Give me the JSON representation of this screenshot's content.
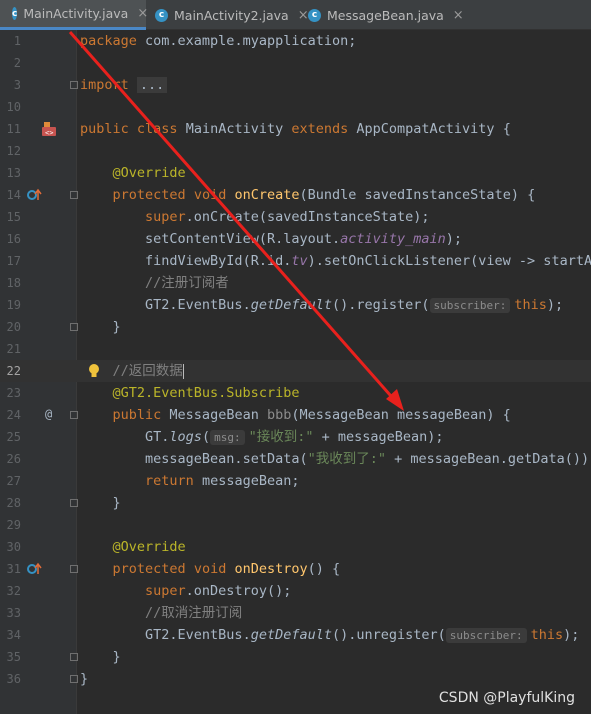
{
  "tabs": [
    {
      "label": "MainActivity.java",
      "icon": "java-class-icon",
      "active": true
    },
    {
      "label": "MainActivity2.java",
      "icon": "java-class-icon",
      "active": false
    },
    {
      "label": "MessageBean.java",
      "icon": "java-class-icon",
      "active": false
    }
  ],
  "line_numbers": [
    "1",
    "2",
    "3",
    "10",
    "11",
    "12",
    "13",
    "14",
    "15",
    "16",
    "17",
    "18",
    "19",
    "20",
    "21",
    "22",
    "23",
    "24",
    "25",
    "26",
    "27",
    "28",
    "29",
    "30",
    "31",
    "32",
    "33",
    "34",
    "35",
    "36"
  ],
  "code": {
    "l1_kw": "package",
    "l1_rest": " com.example.myapplication;",
    "l3_kw": "import",
    "l3_fold": "...",
    "l11_kw1": "public",
    "l11_kw2": "class",
    "l11_name": " MainActivity ",
    "l11_kw3": "extends",
    "l11_rest": " AppCompatActivity {",
    "l13_ann": "@Override",
    "l14_kw1": "protected",
    "l14_kw2": "void",
    "l14_fn": "onCreate",
    "l14_rest": "(Bundle savedInstanceState) {",
    "l15_kw": "super",
    "l15_rest": ".onCreate(savedInstanceState);",
    "l16_a": "setContentView(R.layout.",
    "l16_field": "activity_main",
    "l16_b": ");",
    "l17_a": "findViewById(R.id.",
    "l17_field": "tv",
    "l17_b": ").setOnClickListener(view -> startAc",
    "l18_cmt": "//注册订阅者",
    "l19_a": "GT2.EventBus.",
    "l19_it": "getDefault",
    "l19_b": "().register(",
    "l19_hint": "subscriber:",
    "l19_kw": "this",
    "l19_c": ");",
    "l20": "}",
    "l22_cmt": "//返回数据",
    "l23_ann": "@GT2.EventBus.Subscribe",
    "l24_kw": "public",
    "l24_a": " MessageBean ",
    "l24_unused": "bbb",
    "l24_b": "(MessageBean messageBean) {",
    "l25_a": "GT.",
    "l25_it": "logs",
    "l25_b": "(",
    "l25_hint": "msg:",
    "l25_str": "\"接收到:\"",
    "l25_c": " + messageBean);",
    "l26_a": "messageBean.setData(",
    "l26_str": "\"我收到了:\"",
    "l26_b": " + messageBean.getData());",
    "l27_kw": "return",
    "l27_rest": " messageBean;",
    "l28": "}",
    "l30_ann": "@Override",
    "l31_kw1": "protected",
    "l31_kw2": "void",
    "l31_fn": "onDestroy",
    "l31_rest": "() {",
    "l32_kw": "super",
    "l32_rest": ".onDestroy();",
    "l33_cmt": "//取消注册订阅",
    "l34_a": "GT2.EventBus.",
    "l34_it": "getDefault",
    "l34_b": "().unregister(",
    "l34_hint": "subscriber:",
    "l34_kw": "this",
    "l34_c": ");",
    "l35": "}",
    "l36": "}"
  },
  "gutter_icons": {
    "line11": "android-activity-icon",
    "line14": "override-method-icon",
    "line22": "intention-bulb-icon",
    "line24": "annotation-at-icon",
    "line31": "override-method-icon"
  },
  "annotation_arrow_color": "#e8211d",
  "watermark": "CSDN @PlayfulKing"
}
